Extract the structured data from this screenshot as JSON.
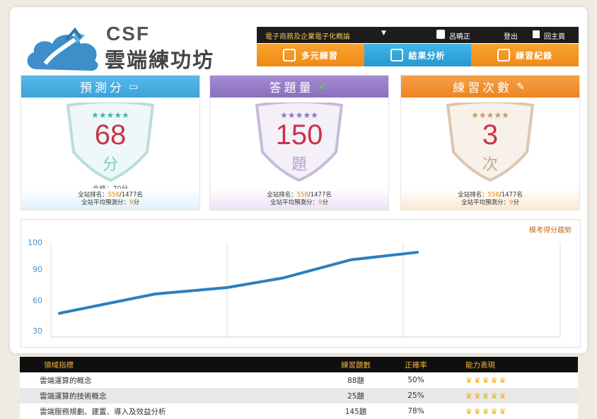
{
  "logo": {
    "en": "CSF",
    "zh": "雲端練功坊"
  },
  "topbar": {
    "course": "電子商務及企業電子化概論",
    "user": "呂曉正",
    "logout": "登出",
    "home": "回主頁"
  },
  "nav": [
    {
      "label": "多元練習",
      "icon": "practice-icon"
    },
    {
      "label": "結果分析",
      "icon": "analysis-icon"
    },
    {
      "label": "練習紀錄",
      "icon": "record-icon"
    }
  ],
  "cards": [
    {
      "title": "預測分",
      "value": "68",
      "unit": "分",
      "pass": "合格：70分",
      "rank_label": "全站排名：",
      "rank": "558",
      "rank_total": "/1477名",
      "avg_label": "全站平均預測分：",
      "avg": "9",
      "avg_unit": "分",
      "icon": "monitor-icon"
    },
    {
      "title": "答題量",
      "value": "150",
      "unit": "題",
      "pass": "",
      "rank_label": "全站排名：",
      "rank": "558",
      "rank_total": "/1477名",
      "avg_label": "全站平均預測分：",
      "avg": "9",
      "avg_unit": "分",
      "icon": "check-icon"
    },
    {
      "title": "練習次數",
      "value": "3",
      "unit": "次",
      "pass": "",
      "rank_label": "全站排名：",
      "rank": "558",
      "rank_total": "/1477名",
      "avg_label": "全站平均預測分：",
      "avg": "9",
      "avg_unit": "分",
      "icon": "pencil-icon"
    }
  ],
  "colors": {
    "nav_orange": "#ef8a12",
    "nav_blue": "#2499d3",
    "score_red": "#c9344a",
    "line_blue": "#2b7fc0"
  },
  "chart_data": {
    "type": "line",
    "title": "模考得分趨勢",
    "yticks": [
      "100",
      "90",
      "60",
      "30"
    ],
    "y_tick_values": [
      100,
      90,
      60,
      30
    ],
    "ylim": [
      30,
      100
    ],
    "x": [
      1,
      2,
      3,
      4,
      5,
      6
    ],
    "series": [
      {
        "values": [
          39,
          57,
          63,
          72,
          89,
          96
        ]
      }
    ],
    "grid": true
  },
  "table": {
    "headers": [
      "領域指標",
      "練習題數",
      "正確率",
      "能力表現"
    ],
    "rows": [
      {
        "domain": "雲端運算的概念",
        "count": "88題",
        "rate": "50%",
        "crowns": "♛♛♛♛♛"
      },
      {
        "domain": "雲端運算的技術概念",
        "count": "25題",
        "rate": "25%",
        "crowns": "♛♛♛♛♛"
      },
      {
        "domain": "雲端服務規劃、建置、導入及效益分析",
        "count": "145題",
        "rate": "78%",
        "crowns": "♛♛♛♛♛"
      }
    ]
  }
}
